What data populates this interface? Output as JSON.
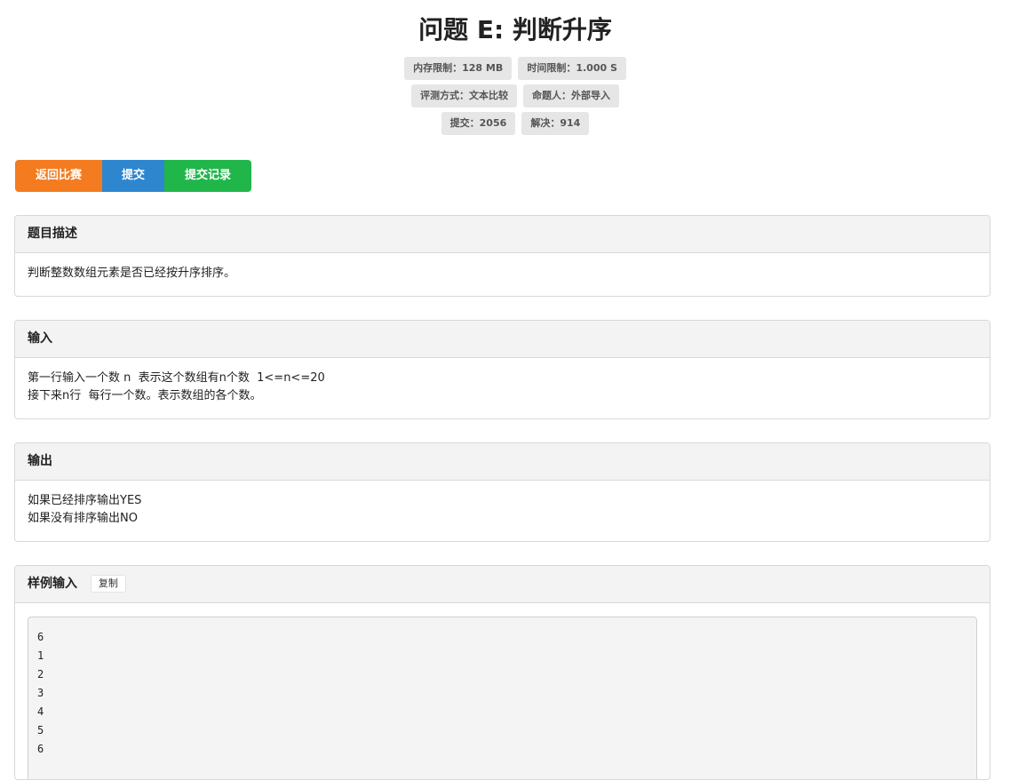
{
  "problem": {
    "title": "问题 E: 判断升序"
  },
  "meta": {
    "memory_limit": "内存限制：128 MB",
    "time_limit": "时间限制：1.000 S",
    "judge_method": "评测方式：文本比较",
    "author": "命题人：外部导入",
    "submissions": "提交：2056",
    "solved": "解决：914"
  },
  "actions": {
    "back_label": "返回比赛",
    "submit_label": "提交",
    "records_label": "提交记录"
  },
  "colors": {
    "orange": "#f47b20",
    "blue": "#2e86cf",
    "green": "#21b64a"
  },
  "description": {
    "heading": "题目描述",
    "text": "判断整数数组元素是否已经按升序排序。"
  },
  "input": {
    "heading": "输入",
    "lines": [
      "第一行输入一个数 n  表示这个数组有n个数  1<=n<=20",
      "接下来n行  每行一个数。表示数组的各个数。"
    ]
  },
  "output": {
    "heading": "输出",
    "lines": [
      "如果已经排序输出YES",
      "如果没有排序输出NO"
    ]
  },
  "sample_input": {
    "heading": "样例输入",
    "copy_label": "复制",
    "lines": [
      "6",
      "1",
      "2",
      "3",
      "4",
      "5",
      "6"
    ]
  }
}
